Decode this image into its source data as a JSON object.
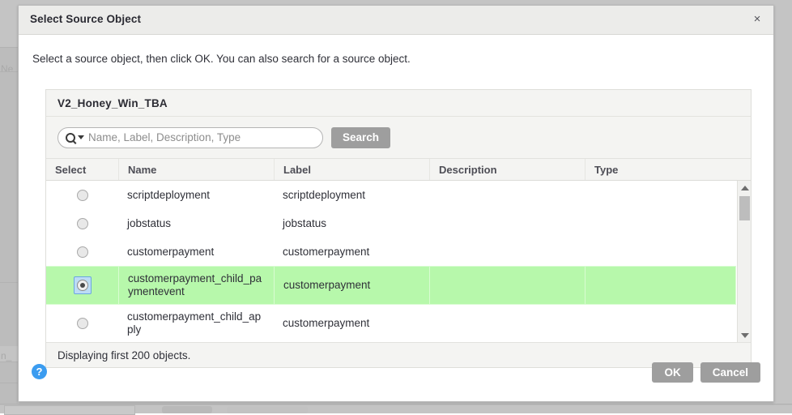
{
  "dialog": {
    "title": "Select Source Object",
    "close_label": "×",
    "instruction": "Select a source object, then click OK. You can also search for a source object.",
    "help_label": "?",
    "ok_label": "OK",
    "cancel_label": "Cancel"
  },
  "panel": {
    "title": "V2_Honey_Win_TBA",
    "status": "Displaying first 200 objects."
  },
  "search": {
    "placeholder": "Name, Label, Description, Type",
    "value": "",
    "button_label": "Search",
    "icon": "search-icon",
    "caret_icon": "chevron-down-icon"
  },
  "table": {
    "columns": [
      "Select",
      "Name",
      "Label",
      "Description",
      "Type"
    ],
    "rows": [
      {
        "selected": false,
        "name": "scriptdeployment",
        "label": "scriptdeployment",
        "description": "",
        "type": ""
      },
      {
        "selected": false,
        "name": "jobstatus",
        "label": "jobstatus",
        "description": "",
        "type": ""
      },
      {
        "selected": false,
        "name": "customerpayment",
        "label": "customerpayment",
        "description": "",
        "type": ""
      },
      {
        "selected": true,
        "name": "customerpayment_child_paymentevent",
        "label": "customerpayment",
        "description": "",
        "type": ""
      },
      {
        "selected": false,
        "name": "customerpayment_child_apply",
        "label": "customerpayment",
        "description": "",
        "type": ""
      }
    ]
  },
  "scrollbar": {
    "up_icon": "triangle-up-icon",
    "down_icon": "triangle-down-icon"
  },
  "background": {
    "text_top": "Ne",
    "text_bottom": "n_"
  },
  "colors": {
    "selected_row": "#b7f8ab",
    "accent_help": "#3b9cf0",
    "button_grey": "#9e9e9e",
    "panel_grey": "#f4f4f2",
    "backdrop": "#c4c4c4"
  }
}
